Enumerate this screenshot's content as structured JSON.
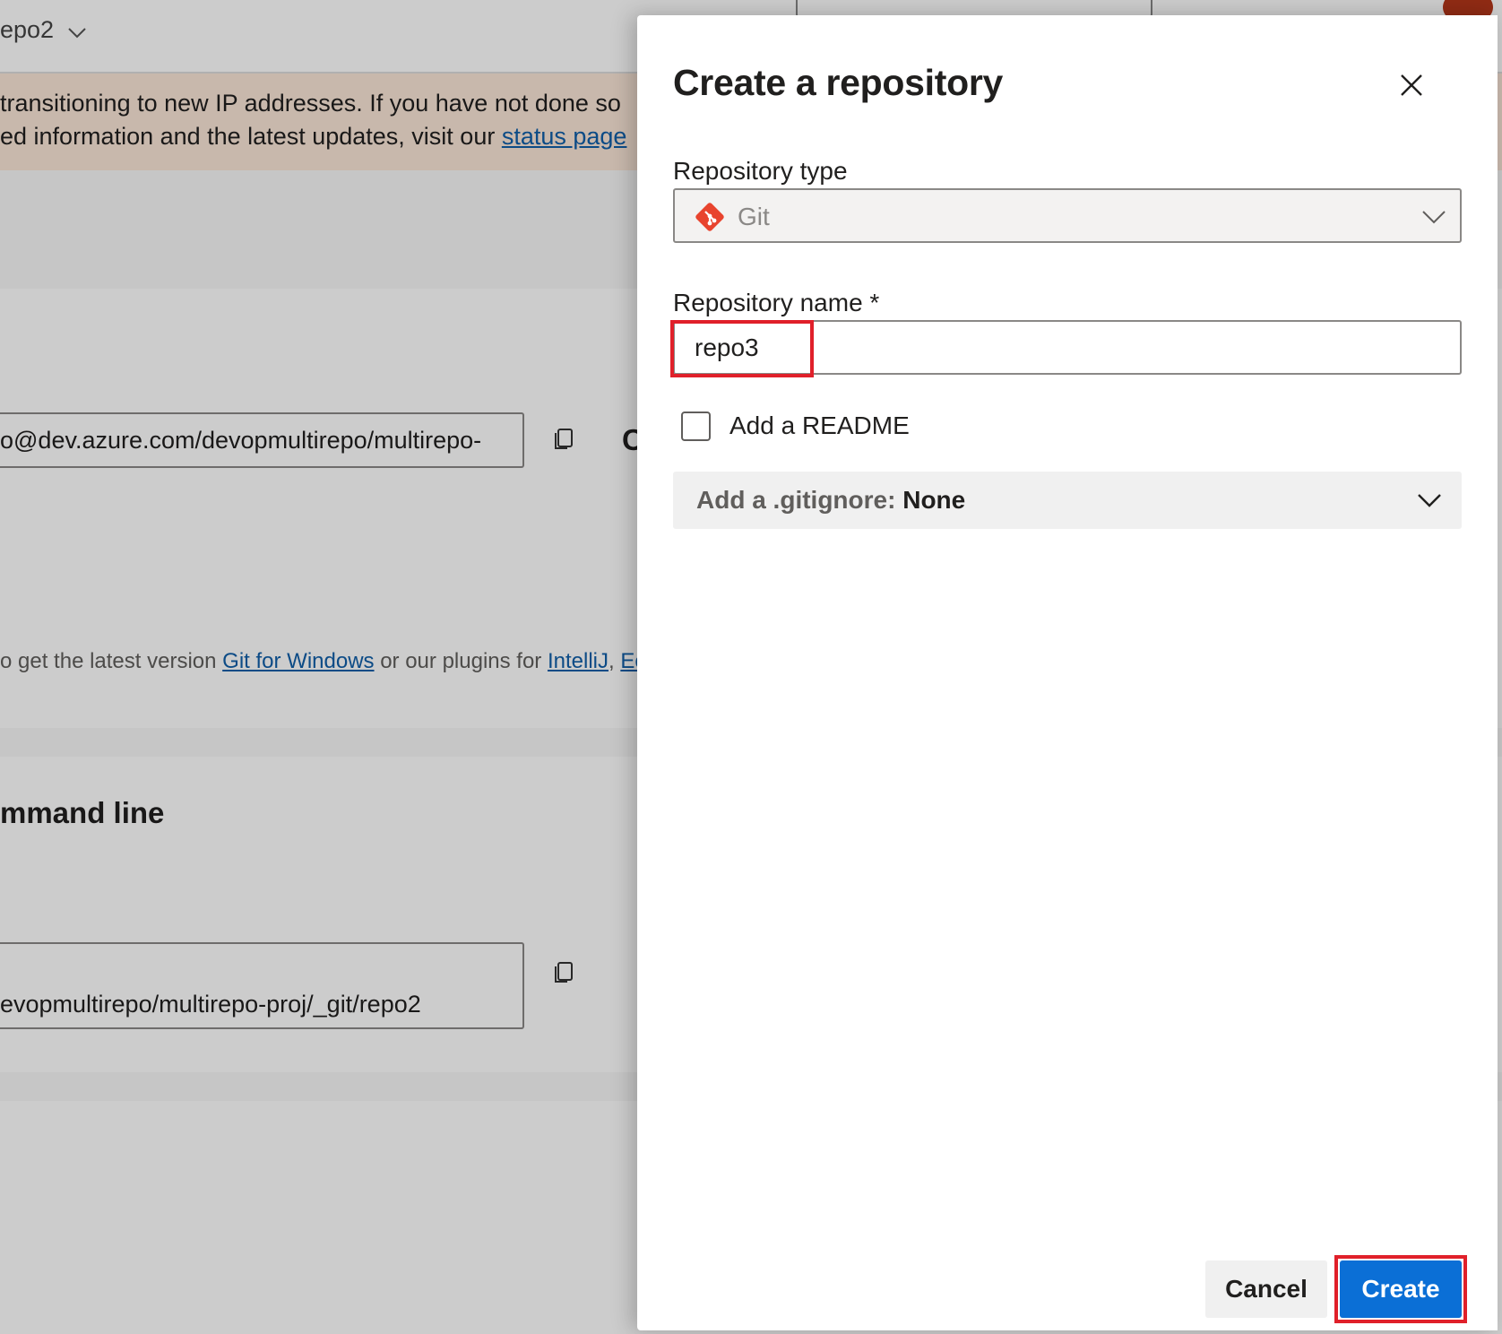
{
  "background": {
    "repo_selector": "epo2",
    "banner_line1": " transitioning to new IP addresses. If you have not done so",
    "banner_line2_text": "ed information and the latest updates, visit our ",
    "banner_link": "status page",
    "clone_url_https": "o@dev.azure.com/devopmultirepo/multirepo-",
    "clone_c": "C",
    "tools_text_start": "o get the latest version ",
    "tools_link_git_windows": "Git for Windows",
    "tools_text_mid": " or our plugins for ",
    "tools_link_intellij": "IntelliJ",
    "tools_text_sep": ", ",
    "tools_link_eclipse": "Ec",
    "section_heading": "mmand line",
    "clone_url_cmd": "evopmultirepo/multirepo-proj/_git/repo2"
  },
  "dialog": {
    "title": "Create a repository",
    "repo_type_label": "Repository type",
    "repo_type_value": "Git",
    "repo_name_label": "Repository name *",
    "repo_name_value": "repo3",
    "readme_label": "Add a README",
    "readme_checked": false,
    "gitignore_label": "Add a .gitignore: ",
    "gitignore_value": "None",
    "cancel_label": "Cancel",
    "create_label": "Create"
  },
  "colors": {
    "accent": "#0b6fd6",
    "highlight": "#e0202a",
    "git_icon": "#e8442e"
  },
  "icons": [
    "chevron-down-icon",
    "copy-icon",
    "close-icon",
    "git-icon"
  ]
}
